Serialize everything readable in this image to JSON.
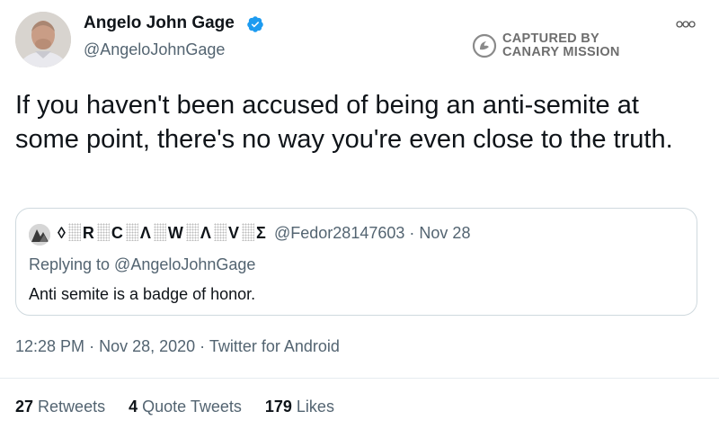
{
  "author": {
    "display_name": "Angelo John Gage",
    "handle": "@AngeloJohnGage",
    "verified_icon": "verified-badge-icon",
    "verified_color": "#1d9bf0"
  },
  "watermark": {
    "line1": "CAPTURED BY",
    "line2": "CANARY MISSION",
    "icon": "canary-mission-icon"
  },
  "menu_icon": "more-options-icon",
  "tweet_text": "If you haven't been accused of being an anti-semite at some point, there's no way you're even close to the truth.",
  "quoted_tweet": {
    "name_chars": [
      "◊",
      "R",
      "C",
      "Λ",
      "W",
      "Λ",
      "V",
      "Σ"
    ],
    "handle": "@Fedor28147603",
    "separator": "·",
    "date": "Nov 28",
    "replying_to": "Replying to @AngeloJohnGage",
    "text": "Anti semite is a badge of honor."
  },
  "meta": {
    "time": "12:28 PM",
    "date": "Nov 28, 2020",
    "source": "Twitter for Android",
    "separator": "·"
  },
  "stats": {
    "retweets_count": "27",
    "retweets_label": "Retweets",
    "quotes_count": "4",
    "quotes_label": "Quote Tweets",
    "likes_count": "179",
    "likes_label": "Likes"
  },
  "colors": {
    "text": "#0f1419",
    "secondary": "#536471",
    "border": "#cfd9de"
  }
}
